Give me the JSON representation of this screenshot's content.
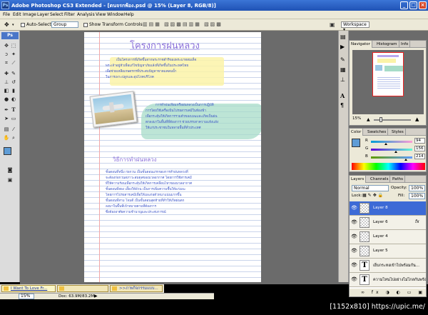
{
  "window": {
    "title": "Adobe Photoshop CS3 Extended - [ตนจรกพ้อง.psd @ 15% (Layer 8, RGB/8)]",
    "logo": "Ps",
    "minimize": "_",
    "maximize": "□",
    "close": "×"
  },
  "menu": [
    "File",
    "Edit",
    "Image",
    "Layer",
    "Select",
    "Filter",
    "Analysis",
    "View",
    "Window",
    "Help"
  ],
  "options": {
    "auto_select_label": "Auto-Select:",
    "auto_select_value": "Group",
    "transform_label": "Show Transform Controls",
    "workspace_label": "Workspace ▾"
  },
  "document": {
    "heading1": "โครงการฝนหลวง",
    "para1": [
      "เป็นโครงการที่เกิดขึ้นจากพระราชดำริของพระบาทสมเด็จ",
      "พระเจ้าอยู่หัวเพื่อแก้ไขปัญหาภัยแล้งที่เกิดขึ้นในประเทศไทย",
      "เพื่อช่วยเหลือเกษตรกรที่ประสบปัญหาขาดแคลนน้ำ",
      "ในการเพาะปลูกและอุปโภคบริโภค"
    ],
    "para2": [
      "การทำฝนเทียมหรือฝนหลวงเป็นการปฏิบัติ",
      "การโดยใช้เครื่องบินโปรยสารเคมีในท้องฟ้า",
      "เพื่อกระตุ้นให้เกิดการรวมตัวของเมฆและเกิดเป็นฝน",
      "ตกลงมาในพื้นที่ที่ต้องการ ช่วยบรรเทาความแห้งแล้ง",
      "ให้แก่ประชาชนในหลายพื้นที่ทั่วประเทศ"
    ],
    "heading2": "วิธีการทำฝนหลวง",
    "para3": [
      "ขั้นตอนที่หนึ่ง ก่อกวน เป็นขั้นตอนแรกของการทำฝนหลวงที่",
      "จะต้องก่อกวนสภาวะสมดุลของมวลอากาศ โดยการใช้สารเคมี",
      "ที่ให้ความร้อนเพื่อกระตุ้นให้เกิดการเคลื่อนไหวของมวลอากาศ",
      "ขั้นตอนที่สอง เลี้ยงให้อ้วน เป็นการเพิ่มความชื้นให้แก่เมฆ",
      "โดยการโปรยสารเคมีเพื่อให้เมฆก่อตัวหนาแน่นมากขึ้น",
      "ขั้นตอนที่สาม โจมตี เป็นขั้นตอนสุดท้ายที่ทำให้เกิดฝนตก",
      "ลงมาในพื้นที่เป้าหมายตามที่ต้องการ",
      "ซึ่งต้องอาศัยความชำนาญและประสบการณ์"
    ]
  },
  "panels": {
    "navigator": {
      "tabs": [
        "Navigator",
        "Histogram",
        "Info"
      ],
      "zoom": "15%"
    },
    "color": {
      "tabs": [
        "Color",
        "Swatches",
        "Styles"
      ],
      "channels": [
        {
          "label": "R",
          "value": "94",
          "fraction": 0.37
        },
        {
          "label": "G",
          "value": "156",
          "fraction": 0.61
        },
        {
          "label": "B",
          "value": "214",
          "fraction": 0.84
        }
      ],
      "swatch": "#5e9cd6"
    },
    "layers": {
      "tabs": [
        "Layers",
        "Channels",
        "Paths"
      ],
      "blend_mode": "Normal",
      "opacity_label": "Opacity:",
      "opacity_value": "100%",
      "lock_label": "Lock:",
      "fill_label": "Fill:",
      "fill_value": "100%",
      "rows": [
        {
          "name": "Layer 8",
          "kind": "raster",
          "selected": true,
          "visible": true
        },
        {
          "name": "Layer 6",
          "kind": "raster",
          "selected": false,
          "visible": true
        },
        {
          "name": "Layer 4",
          "kind": "raster",
          "selected": false,
          "visible": true
        },
        {
          "name": "Layer 5",
          "kind": "raster",
          "selected": false,
          "visible": true
        },
        {
          "name": "เย็บกระทงเข้าไปพร้อมกัน...",
          "kind": "text",
          "selected": false,
          "visible": true
        },
        {
          "name": "ความไหนไปอย่างไม่ไกลกันพร้อม",
          "kind": "text",
          "selected": false,
          "visible": true
        }
      ]
    }
  },
  "status": {
    "zoom": "15%",
    "doc": "Doc: 63.9M/83.2M"
  },
  "taskbar": [
    {
      "label": "I Want To Love Fr...",
      "active": true
    },
    {
      "label": "",
      "active": false
    },
    {
      "label": ">>ภาพกิจกรรมแบบ...",
      "active": false
    }
  ],
  "watermark": "[1152x810] https://upic.me/",
  "colors": {
    "title_bar": "#2a62c8",
    "selection": "#3d6ad6",
    "thai_text": "#3a53c7",
    "heading": "#8a6fd9"
  }
}
